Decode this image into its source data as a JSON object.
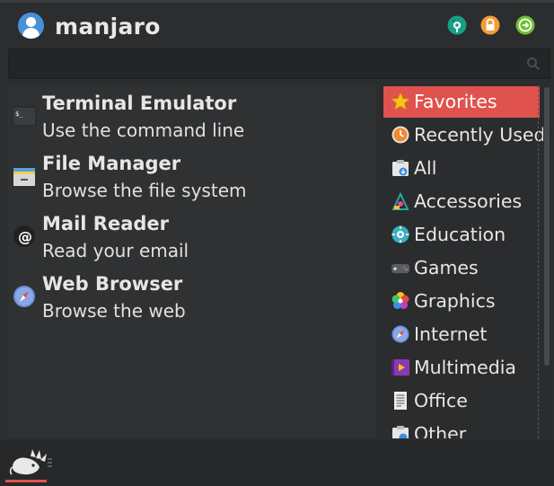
{
  "header": {
    "username": "manjaro",
    "buttons": [
      {
        "name": "settings-button",
        "icon": "gear-wrench-icon",
        "color": "#17a085"
      },
      {
        "name": "lock-button",
        "icon": "lock-icon",
        "color": "#f39c34"
      },
      {
        "name": "logout-button",
        "icon": "logout-icon",
        "color": "#6fbf33"
      }
    ]
  },
  "search": {
    "value": "",
    "placeholder": ""
  },
  "favorites": [
    {
      "name": "Terminal Emulator",
      "description": "Use the command line",
      "icon": "terminal-icon"
    },
    {
      "name": "File Manager",
      "description": "Browse the file system",
      "icon": "file-manager-icon"
    },
    {
      "name": "Mail Reader",
      "description": "Read your email",
      "icon": "mail-icon"
    },
    {
      "name": "Web Browser",
      "description": "Browse the web",
      "icon": "web-browser-icon"
    }
  ],
  "categories": [
    {
      "label": "Favorites",
      "icon": "star-icon",
      "active": true
    },
    {
      "label": "Recently Used",
      "icon": "recent-icon",
      "active": false
    },
    {
      "label": "All",
      "icon": "all-apps-icon",
      "active": false
    },
    {
      "label": "Accessories",
      "icon": "accessories-icon",
      "active": false
    },
    {
      "label": "Education",
      "icon": "education-icon",
      "active": false
    },
    {
      "label": "Games",
      "icon": "gamepad-icon",
      "active": false
    },
    {
      "label": "Graphics",
      "icon": "graphics-icon",
      "active": false
    },
    {
      "label": "Internet",
      "icon": "internet-icon",
      "active": false
    },
    {
      "label": "Multimedia",
      "icon": "multimedia-icon",
      "active": false
    },
    {
      "label": "Office",
      "icon": "office-icon",
      "active": false
    },
    {
      "label": "Other",
      "icon": "other-icon",
      "active": false
    }
  ],
  "colors": {
    "accent": "#e0524d",
    "background": "#2b2d2f"
  }
}
